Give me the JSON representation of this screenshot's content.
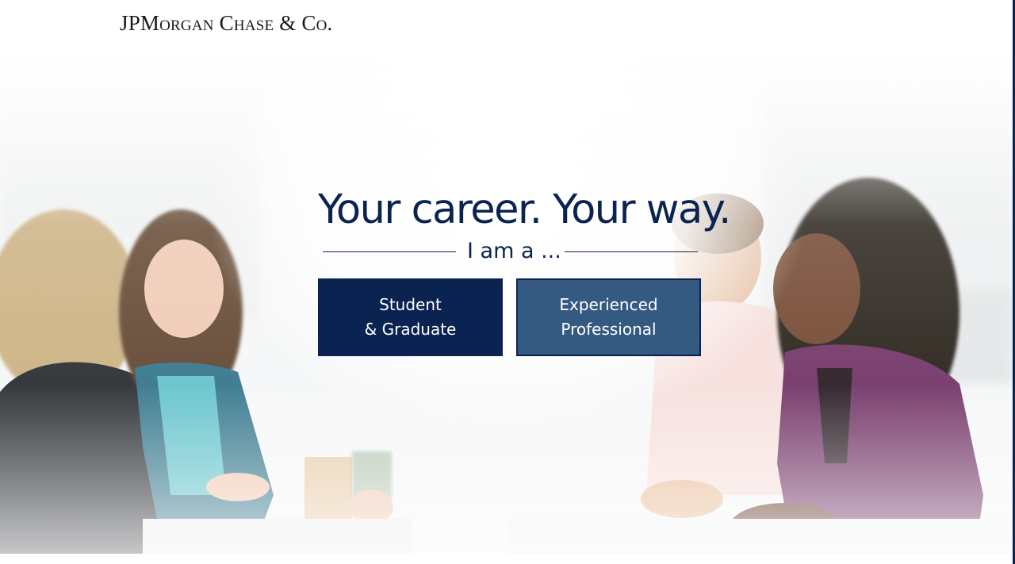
{
  "brand": {
    "logo_text": "JPMorgan Chase & Co."
  },
  "hero": {
    "headline": "Your career. Your way.",
    "prompt": "I am a ...",
    "choices": [
      {
        "line1": "Student",
        "line2": "& Graduate"
      },
      {
        "line1": "Experienced",
        "line2": "Professional"
      }
    ]
  },
  "colors": {
    "brand_navy": "#0b2350",
    "experienced_button": "#355a82",
    "background": "#ffffff"
  },
  "icons": []
}
